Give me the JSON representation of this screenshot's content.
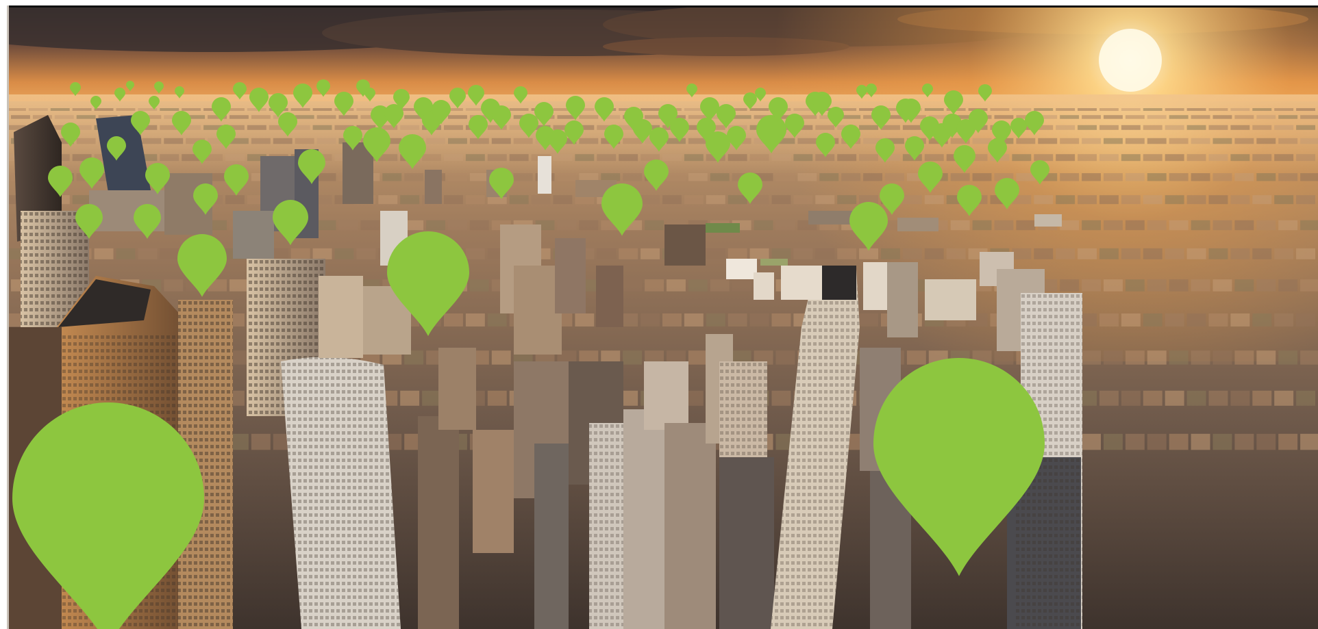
{
  "scene": {
    "description_kind": "photo",
    "colors": {
      "pin": "#8dc63f",
      "pin_dark": "#7fb637",
      "sky_top": "#3a2f2c",
      "sky_glow": "#f6a347",
      "sun": "#fff3c4",
      "city_far": "#b68b63",
      "city_mid": "#8a6e57",
      "city_near": "#4a3b32",
      "frame_border": "#111111"
    },
    "icons": [
      "map-pin-icon"
    ]
  }
}
